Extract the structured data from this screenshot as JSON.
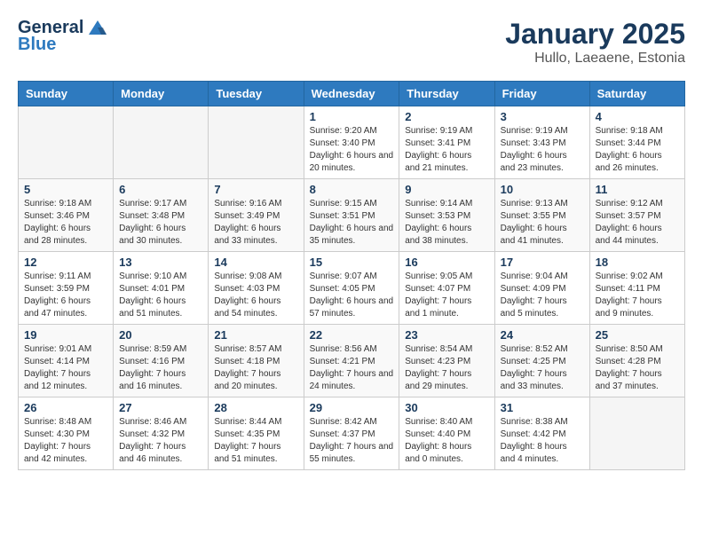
{
  "header": {
    "logo_general": "General",
    "logo_blue": "Blue",
    "month_title": "January 2025",
    "location": "Hullo, Laeaene, Estonia"
  },
  "days_of_week": [
    "Sunday",
    "Monday",
    "Tuesday",
    "Wednesday",
    "Thursday",
    "Friday",
    "Saturday"
  ],
  "weeks": [
    {
      "days": [
        {
          "num": "",
          "info": ""
        },
        {
          "num": "",
          "info": ""
        },
        {
          "num": "",
          "info": ""
        },
        {
          "num": "1",
          "info": "Sunrise: 9:20 AM\nSunset: 3:40 PM\nDaylight: 6 hours\nand 20 minutes."
        },
        {
          "num": "2",
          "info": "Sunrise: 9:19 AM\nSunset: 3:41 PM\nDaylight: 6 hours\nand 21 minutes."
        },
        {
          "num": "3",
          "info": "Sunrise: 9:19 AM\nSunset: 3:43 PM\nDaylight: 6 hours\nand 23 minutes."
        },
        {
          "num": "4",
          "info": "Sunrise: 9:18 AM\nSunset: 3:44 PM\nDaylight: 6 hours\nand 26 minutes."
        }
      ]
    },
    {
      "days": [
        {
          "num": "5",
          "info": "Sunrise: 9:18 AM\nSunset: 3:46 PM\nDaylight: 6 hours\nand 28 minutes."
        },
        {
          "num": "6",
          "info": "Sunrise: 9:17 AM\nSunset: 3:48 PM\nDaylight: 6 hours\nand 30 minutes."
        },
        {
          "num": "7",
          "info": "Sunrise: 9:16 AM\nSunset: 3:49 PM\nDaylight: 6 hours\nand 33 minutes."
        },
        {
          "num": "8",
          "info": "Sunrise: 9:15 AM\nSunset: 3:51 PM\nDaylight: 6 hours\nand 35 minutes."
        },
        {
          "num": "9",
          "info": "Sunrise: 9:14 AM\nSunset: 3:53 PM\nDaylight: 6 hours\nand 38 minutes."
        },
        {
          "num": "10",
          "info": "Sunrise: 9:13 AM\nSunset: 3:55 PM\nDaylight: 6 hours\nand 41 minutes."
        },
        {
          "num": "11",
          "info": "Sunrise: 9:12 AM\nSunset: 3:57 PM\nDaylight: 6 hours\nand 44 minutes."
        }
      ]
    },
    {
      "days": [
        {
          "num": "12",
          "info": "Sunrise: 9:11 AM\nSunset: 3:59 PM\nDaylight: 6 hours\nand 47 minutes."
        },
        {
          "num": "13",
          "info": "Sunrise: 9:10 AM\nSunset: 4:01 PM\nDaylight: 6 hours\nand 51 minutes."
        },
        {
          "num": "14",
          "info": "Sunrise: 9:08 AM\nSunset: 4:03 PM\nDaylight: 6 hours\nand 54 minutes."
        },
        {
          "num": "15",
          "info": "Sunrise: 9:07 AM\nSunset: 4:05 PM\nDaylight: 6 hours\nand 57 minutes."
        },
        {
          "num": "16",
          "info": "Sunrise: 9:05 AM\nSunset: 4:07 PM\nDaylight: 7 hours\nand 1 minute."
        },
        {
          "num": "17",
          "info": "Sunrise: 9:04 AM\nSunset: 4:09 PM\nDaylight: 7 hours\nand 5 minutes."
        },
        {
          "num": "18",
          "info": "Sunrise: 9:02 AM\nSunset: 4:11 PM\nDaylight: 7 hours\nand 9 minutes."
        }
      ]
    },
    {
      "days": [
        {
          "num": "19",
          "info": "Sunrise: 9:01 AM\nSunset: 4:14 PM\nDaylight: 7 hours\nand 12 minutes."
        },
        {
          "num": "20",
          "info": "Sunrise: 8:59 AM\nSunset: 4:16 PM\nDaylight: 7 hours\nand 16 minutes."
        },
        {
          "num": "21",
          "info": "Sunrise: 8:57 AM\nSunset: 4:18 PM\nDaylight: 7 hours\nand 20 minutes."
        },
        {
          "num": "22",
          "info": "Sunrise: 8:56 AM\nSunset: 4:21 PM\nDaylight: 7 hours\nand 24 minutes."
        },
        {
          "num": "23",
          "info": "Sunrise: 8:54 AM\nSunset: 4:23 PM\nDaylight: 7 hours\nand 29 minutes."
        },
        {
          "num": "24",
          "info": "Sunrise: 8:52 AM\nSunset: 4:25 PM\nDaylight: 7 hours\nand 33 minutes."
        },
        {
          "num": "25",
          "info": "Sunrise: 8:50 AM\nSunset: 4:28 PM\nDaylight: 7 hours\nand 37 minutes."
        }
      ]
    },
    {
      "days": [
        {
          "num": "26",
          "info": "Sunrise: 8:48 AM\nSunset: 4:30 PM\nDaylight: 7 hours\nand 42 minutes."
        },
        {
          "num": "27",
          "info": "Sunrise: 8:46 AM\nSunset: 4:32 PM\nDaylight: 7 hours\nand 46 minutes."
        },
        {
          "num": "28",
          "info": "Sunrise: 8:44 AM\nSunset: 4:35 PM\nDaylight: 7 hours\nand 51 minutes."
        },
        {
          "num": "29",
          "info": "Sunrise: 8:42 AM\nSunset: 4:37 PM\nDaylight: 7 hours\nand 55 minutes."
        },
        {
          "num": "30",
          "info": "Sunrise: 8:40 AM\nSunset: 4:40 PM\nDaylight: 8 hours\nand 0 minutes."
        },
        {
          "num": "31",
          "info": "Sunrise: 8:38 AM\nSunset: 4:42 PM\nDaylight: 8 hours\nand 4 minutes."
        },
        {
          "num": "",
          "info": ""
        }
      ]
    }
  ]
}
